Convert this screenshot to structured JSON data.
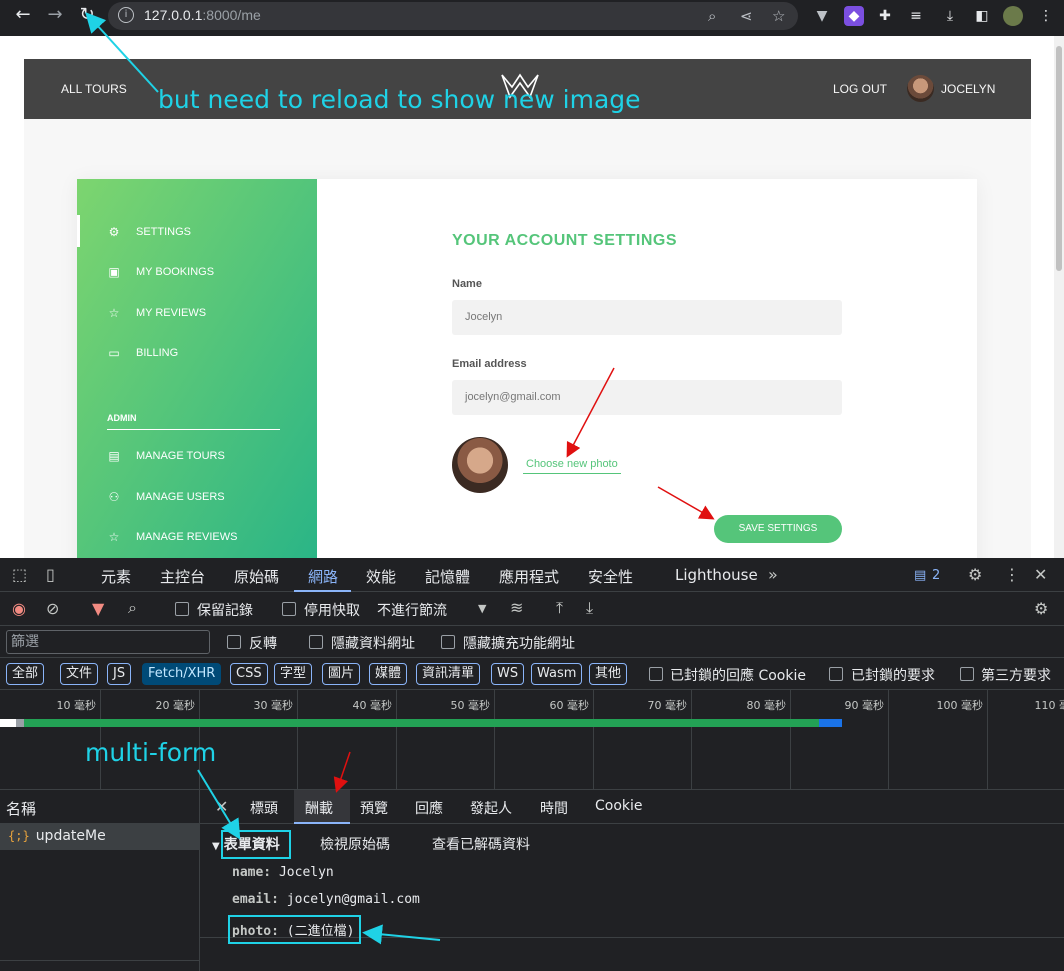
{
  "browser": {
    "url_host": "127.0.0.1",
    "url_path": ":8000/me"
  },
  "site": {
    "nav_left": "ALL TOURS",
    "nav_logout": "LOG OUT",
    "nav_user": "JOCELYN"
  },
  "sidebar": {
    "items": [
      {
        "label": "SETTINGS",
        "icon": "gear-icon"
      },
      {
        "label": "MY BOOKINGS",
        "icon": "briefcase-icon"
      },
      {
        "label": "MY REVIEWS",
        "icon": "star-icon"
      },
      {
        "label": "BILLING",
        "icon": "credit-card-icon"
      }
    ],
    "admin_label": "ADMIN",
    "admin_items": [
      {
        "label": "MANAGE TOURS",
        "icon": "map-icon"
      },
      {
        "label": "MANAGE USERS",
        "icon": "users-icon"
      },
      {
        "label": "MANAGE REVIEWS",
        "icon": "star-icon"
      }
    ]
  },
  "settings": {
    "title": "YOUR ACCOUNT SETTINGS",
    "name_label": "Name",
    "name_value": "Jocelyn",
    "email_label": "Email address",
    "email_value": "jocelyn@gmail.com",
    "choose_photo": "Choose new photo",
    "save_button": "SAVE SETTINGS"
  },
  "devtools": {
    "tabs": [
      "元素",
      "主控台",
      "原始碼",
      "網路",
      "效能",
      "記憶體",
      "應用程式",
      "安全性",
      "Lighthouse"
    ],
    "active_tab": "網路",
    "issues_count": "2",
    "toolbar": {
      "preserve_log": "保留記錄",
      "disable_cache": "停用快取",
      "throttling": "不進行節流"
    },
    "filter": {
      "placeholder": "篩選",
      "invert": "反轉",
      "hide_data_urls": "隱藏資料網址",
      "hide_extension_urls": "隱藏擴充功能網址"
    },
    "types": [
      "全部",
      "文件",
      "JS",
      "Fetch/XHR",
      "CSS",
      "字型",
      "圖片",
      "媒體",
      "資訊清單",
      "WS",
      "Wasm",
      "其他"
    ],
    "active_type": "Fetch/XHR",
    "cookie_filters": {
      "blocked_response_cookies": "已封鎖的回應 Cookie",
      "blocked_requests": "已封鎖的要求",
      "third_party": "第三方要求"
    },
    "timeline_ticks": [
      "10 毫秒",
      "20 毫秒",
      "30 毫秒",
      "40 毫秒",
      "50 毫秒",
      "60 毫秒",
      "70 毫秒",
      "80 毫秒",
      "90 毫秒",
      "100 毫秒",
      "110 毫秒"
    ],
    "requests_header": "名稱",
    "request_name": "updateMe",
    "detail_tabs": [
      "標頭",
      "酬載",
      "預覽",
      "回應",
      "發起人",
      "時間",
      "Cookie"
    ],
    "active_detail_tab": "酬載",
    "payload": {
      "section_title": "表單資料",
      "view_source": "檢視原始碼",
      "view_decoded": "查看已解碼資料",
      "fields": [
        {
          "key": "name:",
          "value": "Jocelyn"
        },
        {
          "key": "email:",
          "value": "jocelyn@gmail.com"
        },
        {
          "key": "photo:",
          "value": "(二進位檔)"
        }
      ]
    }
  },
  "annotations": {
    "reload_note": "but need to reload to show new image",
    "multi_form_note": "multi-form",
    "color": "#1fd2e6",
    "arrow_red": "#e01010"
  }
}
